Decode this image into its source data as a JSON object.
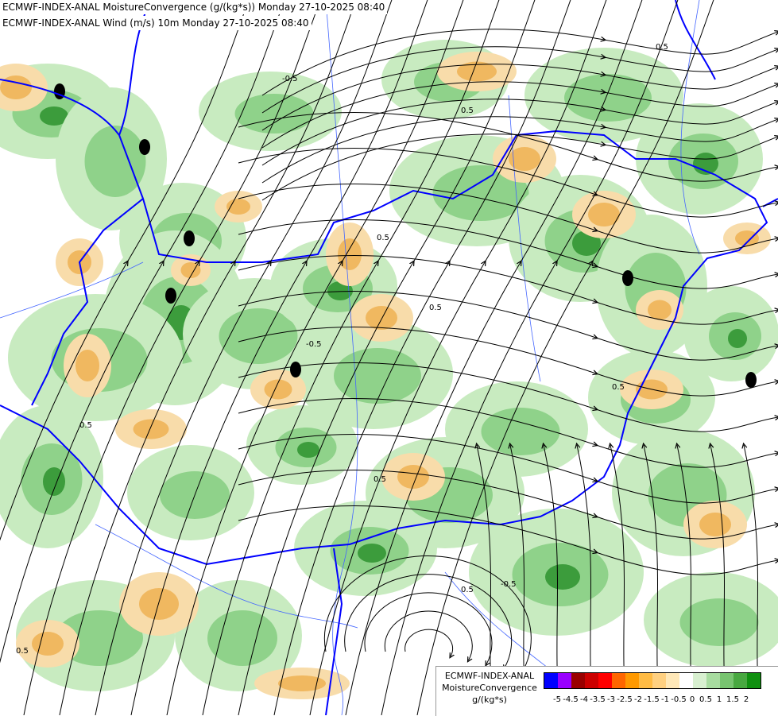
{
  "titles": {
    "line1": "ECMWF-INDEX-ANAL MoistureConvergence (g/(kg*s)) Monday 27-10-2025 08:40",
    "line2": "ECMWF-INDEX-ANAL Wind (m/s) 10m Monday 27-10-2025 08:40"
  },
  "contour_labels": [
    "0.5",
    "-0.5",
    "0.5",
    "0.5",
    "-0.5",
    "0.5",
    "0.5",
    "0.5",
    "0.5",
    "-0.5",
    "0.5",
    "0.5"
  ],
  "legend": {
    "model": "ECMWF-INDEX-ANAL",
    "variable": "MoistureConvergence",
    "unit": "g/(kg*s)",
    "colors": [
      "#0000ff",
      "#9900ff",
      "#990000",
      "#cc0000",
      "#ff0000",
      "#ff6600",
      "#ff9900",
      "#ffbb44",
      "#ffd080",
      "#ffe8b8",
      "#ffffff",
      "#d8f0d0",
      "#a8dca0",
      "#78c470",
      "#48a840",
      "#109010"
    ],
    "ticks": [
      "-5",
      "-4.5",
      "-4",
      "-3.5",
      "-3",
      "-2.5",
      "-2",
      "-1.5",
      "-1",
      "-0.5",
      "0",
      "0.5",
      "1",
      "1.5",
      "2"
    ]
  },
  "colors": {
    "border": "#0000ff",
    "streamline": "#000000",
    "river": "#4466ff",
    "green_light": "#c8ebc0",
    "green_mid": "#8fd28a",
    "green_dark": "#3c9c3c",
    "orange_light": "#f8dcaa",
    "orange_mid": "#f0b860"
  }
}
